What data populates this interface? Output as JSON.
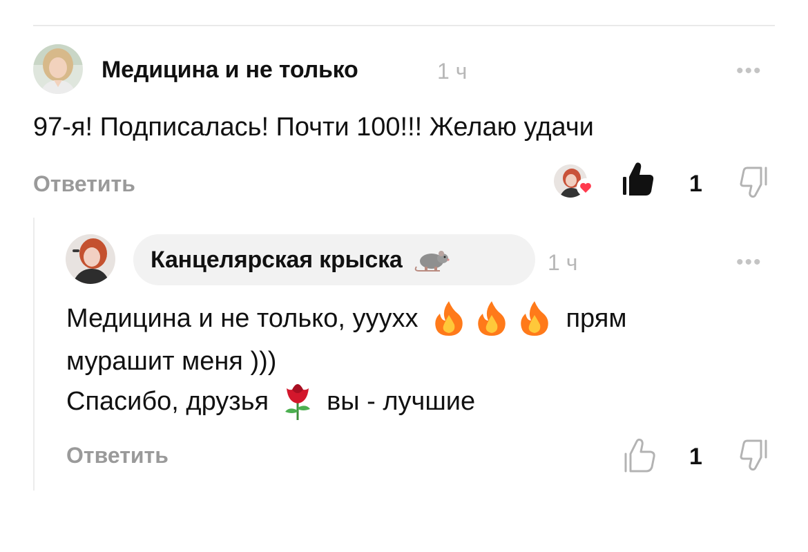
{
  "comment": {
    "author": "Медицина и не только",
    "time": "1 ч",
    "text": "97-я! Подписалась! Почти 100!!! Желаю удачи",
    "reply_label": "Ответить",
    "like_count": "1",
    "icons": {
      "more": "more-icon",
      "like": "thumbs-up-filled-icon",
      "dislike": "thumbs-down-icon",
      "author_liked": "heart-badge-icon"
    }
  },
  "reply": {
    "author": "Канцелярская крыска",
    "author_emoji": "🐀",
    "time": "1 ч",
    "line1_start": "Медицина и не только, уууxx",
    "line1_end": "прям",
    "line2": "мурашит меня )))",
    "line3_start": "Спасибо, друзья",
    "line3_end": "вы - лучшие",
    "reply_label": "Ответить",
    "like_count": "1",
    "icons": {
      "more": "more-icon",
      "like": "thumbs-up-outline-icon",
      "dislike": "thumbs-down-icon",
      "fire": "fire-emoji-icon",
      "rose": "rose-emoji-icon"
    }
  },
  "colors": {
    "muted_text": "#9a9a9a",
    "time_text": "#b7b7b7",
    "heart": "#ff3b4f",
    "pill_bg": "#f2f2f2"
  }
}
